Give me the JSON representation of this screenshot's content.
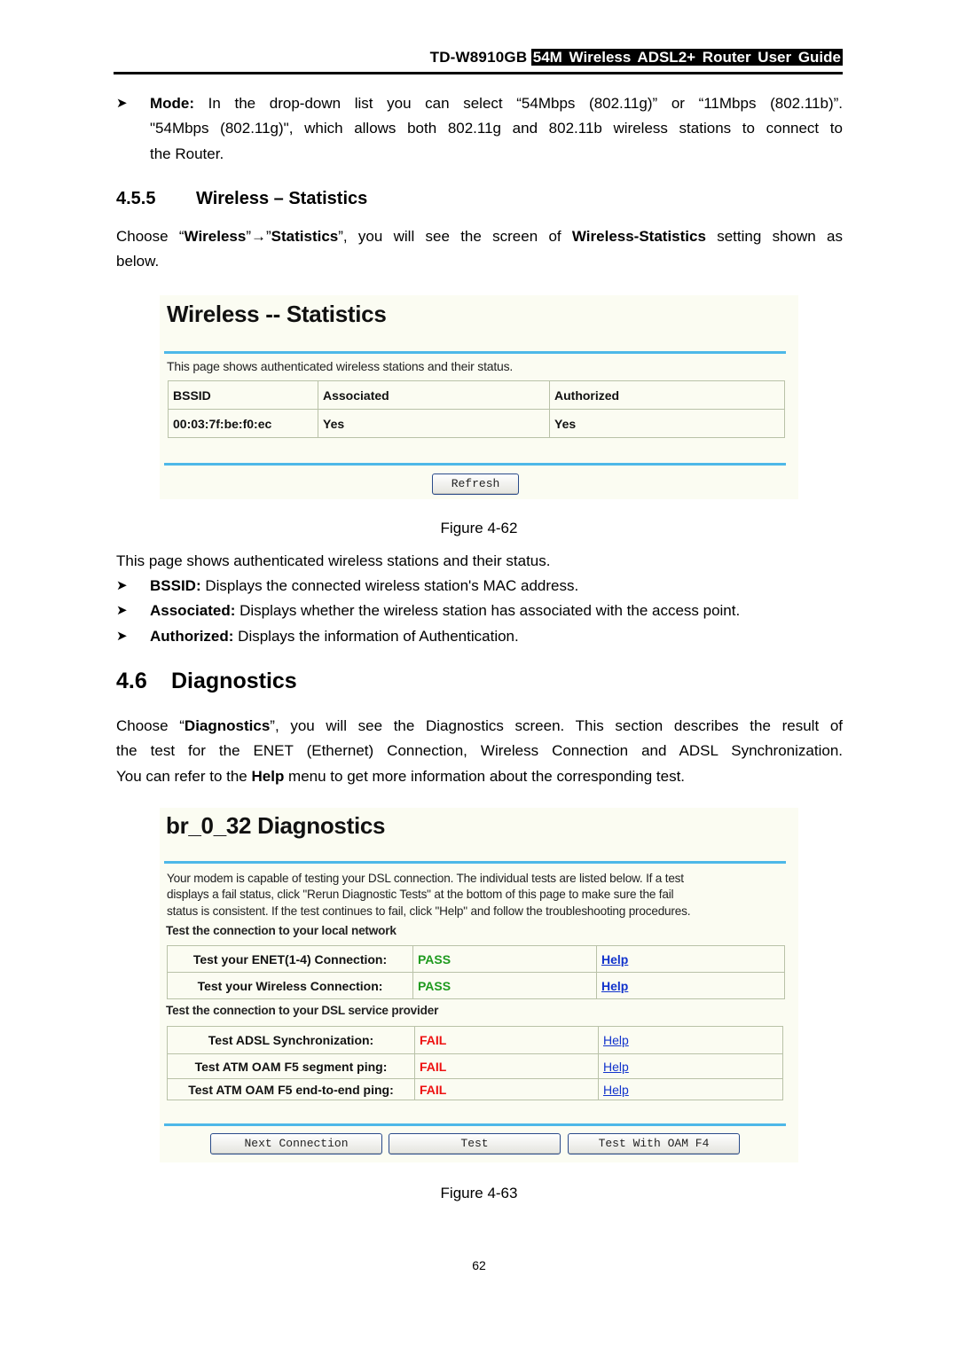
{
  "header": {
    "model": "TD-W8910GB",
    "guide": "54M Wireless ADSL2+ Router User Guide"
  },
  "mode_bullet": {
    "label": "Mode:",
    "line1": " In the drop-down list you can select “54Mbps (802.11g)” or “11Mbps (802.11b)”.",
    "line2": "\"54Mbps (802.11g)\", which allows both 802.11g and 802.11b wireless stations to connect to",
    "line3": "the Router."
  },
  "section_455": {
    "number": "4.5.5",
    "title": "Wireless – Statistics",
    "intro_pre": "Choose “",
    "intro_b1": "Wireless",
    "intro_mid": "”→”",
    "intro_b2": "Statistics",
    "intro_mid2": "”, you will see the screen of ",
    "intro_b3": "Wireless-Statistics",
    "intro_post": " setting shown as",
    "intro_line2": "below."
  },
  "fig62": {
    "title": "Wireless -- Statistics",
    "description": "This page shows authenticated wireless stations and their status.",
    "columns": [
      "BSSID",
      "Associated",
      "Authorized"
    ],
    "rows": [
      [
        "00:03:7f:be:f0:ec",
        "Yes",
        "Yes"
      ]
    ],
    "refresh_button": "Refresh",
    "caption": "Figure 4-62"
  },
  "stats_text": {
    "intro": "This page shows authenticated wireless stations and their status.",
    "bullets": [
      {
        "label": "BSSID:",
        "text": " Displays the connected wireless station's MAC address."
      },
      {
        "label": "Associated:",
        "text": " Displays whether the wireless station has associated with the access point."
      },
      {
        "label": "Authorized:",
        "text": " Displays the information of Authentication."
      }
    ]
  },
  "section_46": {
    "number": "4.6",
    "title": "Diagnostics",
    "p_pre": "Choose “",
    "p_b1": "Diagnostics",
    "p_post1": "”, you will see the Diagnostics screen. This section describes the result of",
    "line2": "the test for the ENET (Ethernet) Connection, Wireless Connection and ADSL Synchronization.",
    "line3_pre": "You can refer to the ",
    "line3_b": "Help",
    "line3_post": " menu to get more information about the corresponding test."
  },
  "fig63": {
    "title": "br_0_32 Diagnostics",
    "desc_lines": [
      "Your modem is capable of testing your DSL connection. The individual tests are listed below. If a test",
      "displays a fail status, click \"Rerun Diagnostic Tests\" at the bottom of this page to make sure the fail",
      "status is consistent. If the test continues to fail, click \"Help\" and follow the troubleshooting procedures."
    ],
    "local_heading": "Test the connection to your local network",
    "local_tests": [
      {
        "label": "Test your ENET(1-4) Connection:",
        "result": "PASS",
        "help": "Help"
      },
      {
        "label": "Test your Wireless Connection:",
        "result": "PASS",
        "help": "Help"
      }
    ],
    "dsl_heading": "Test the connection to your DSL service provider",
    "dsl_tests": [
      {
        "label": "Test ADSL Synchronization:",
        "result": "FAIL",
        "help": "Help"
      },
      {
        "label": "Test ATM OAM F5 segment ping:",
        "result": "FAIL",
        "help": "Help"
      },
      {
        "label": "Test ATM OAM F5 end-to-end ping:",
        "result": "FAIL",
        "help": "Help"
      }
    ],
    "buttons": [
      "Next Connection",
      "Test",
      "Test With OAM F4"
    ],
    "caption": "Figure 4-63"
  },
  "page_number": "62",
  "colors": {
    "accent_rule": "#4db8e8",
    "pass": "#1e9a1e",
    "fail": "#ee1111",
    "link": "#1133cc",
    "screenshot_bg": "#fbfcf2"
  }
}
